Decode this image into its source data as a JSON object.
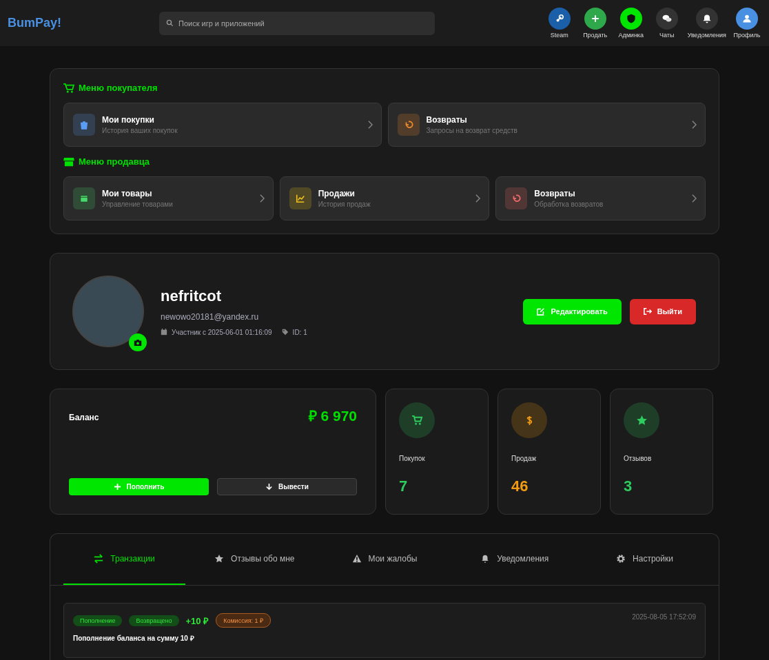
{
  "header": {
    "logo": "BumPay!",
    "search": {
      "placeholder": "Поиск игр и приложений"
    },
    "nav": [
      {
        "kind": "steam",
        "label": "Steam",
        "color": "#1b5fa8"
      },
      {
        "kind": "plus",
        "label": "Продать",
        "color": "#2ea84a"
      },
      {
        "kind": "shield",
        "label": "Админка",
        "color": "#00e600"
      },
      {
        "kind": "chat",
        "label": "Чаты",
        "color": "#333333"
      },
      {
        "kind": "bell",
        "label": "Уведомления",
        "color": "#333333"
      },
      {
        "kind": "user",
        "label": "Профиль",
        "color": "#4a90e2"
      }
    ]
  },
  "menus": [
    {
      "kind": "cart",
      "title": "Меню покупателя",
      "items": [
        {
          "kind": "bag",
          "title": "Мои покупки",
          "subtitle": "История ваших покупок",
          "color": "#5b9cf5"
        },
        {
          "kind": "undo",
          "title": "Возвраты",
          "subtitle": "Запросы на возврат средств",
          "color": "#f08a2c"
        }
      ]
    },
    {
      "kind": "store",
      "title": "Меню продавца",
      "items": [
        {
          "kind": "box",
          "title": "Мои товары",
          "subtitle": "Управление товарами",
          "color": "#4bd66b"
        },
        {
          "kind": "chart",
          "title": "Продажи",
          "subtitle": "История продаж",
          "color": "#f2c21b"
        },
        {
          "kind": "undo",
          "title": "Возвраты",
          "subtitle": "Обработка возвратов",
          "color": "#f06b6b"
        }
      ]
    }
  ],
  "profile": {
    "username": "nefritcot",
    "email": "newowo20181@yandex.ru",
    "member_since": "Участник с 2025-06-01 01:16:09",
    "id": "ID: 1",
    "buttons": [
      {
        "kind": "edit",
        "label": "Редактировать"
      },
      {
        "kind": "logout",
        "label": "Выйти"
      }
    ]
  },
  "balance": {
    "label": "Баланс",
    "currency": "₽",
    "amount": "6 970",
    "buttons": [
      {
        "kind": "deposit",
        "label": "Пополнить"
      },
      {
        "kind": "withdraw",
        "label": "Вывести"
      }
    ]
  },
  "stats": [
    {
      "kind": "cart",
      "label": "Покупок",
      "value": "7",
      "color": "#2ecc5f"
    },
    {
      "kind": "dollar",
      "label": "Продаж",
      "value": "46",
      "color": "#f39c12"
    },
    {
      "kind": "star",
      "label": "Отзывов",
      "value": "3",
      "color": "#2ecc5f"
    }
  ],
  "tabs": [
    {
      "kind": "swap",
      "label": "Транзакции",
      "selected": true
    },
    {
      "kind": "star",
      "label": "Отзывы обо мне",
      "selected": false
    },
    {
      "kind": "warn",
      "label": "Мои жалобы",
      "selected": false
    },
    {
      "kind": "bell",
      "label": "Уведомления",
      "selected": false
    },
    {
      "kind": "gear",
      "label": "Настройки",
      "selected": false
    }
  ],
  "transactions": [
    {
      "type": "Пополнение",
      "status": "Возвращено",
      "amount": "+10 ₽",
      "commission": "Комиссия: 1 ₽",
      "date": "2025-08-05 17:52:09",
      "description": "Пополнение баланса на сумму 10 ₽"
    }
  ]
}
